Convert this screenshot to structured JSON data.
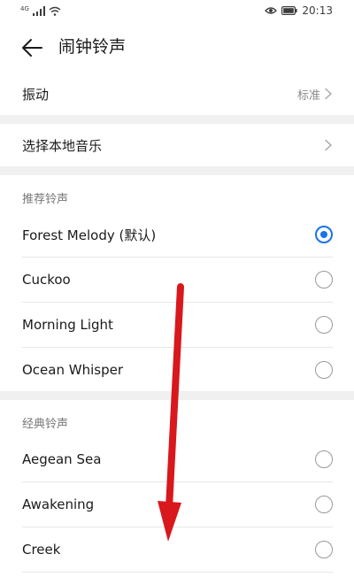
{
  "status_bar": {
    "signal_label": "4G",
    "time": "20:13",
    "battery_icon": "battery-icon",
    "eye_icon": "eye-icon",
    "wifi_icon": "wifi-icon"
  },
  "header": {
    "title": "闹钟铃声",
    "back_icon": "back-arrow-icon"
  },
  "settings": {
    "vibration_label": "振动",
    "vibration_value": "标准",
    "local_music_label": "选择本地音乐"
  },
  "sections": {
    "recommended_title": "推荐铃声",
    "classic_title": "经典铃声"
  },
  "recommended": [
    {
      "label": "Forest Melody (默认)",
      "selected": true
    },
    {
      "label": "Cuckoo",
      "selected": false
    },
    {
      "label": "Morning Light",
      "selected": false
    },
    {
      "label": "Ocean Whisper",
      "selected": false
    }
  ],
  "classic": [
    {
      "label": "Aegean Sea",
      "selected": false
    },
    {
      "label": "Awakening",
      "selected": false
    },
    {
      "label": "Creek",
      "selected": false
    }
  ],
  "colors": {
    "accent": "#1a73e8",
    "annotation_arrow": "#d8181c",
    "section_band": "#f0f0f0"
  }
}
